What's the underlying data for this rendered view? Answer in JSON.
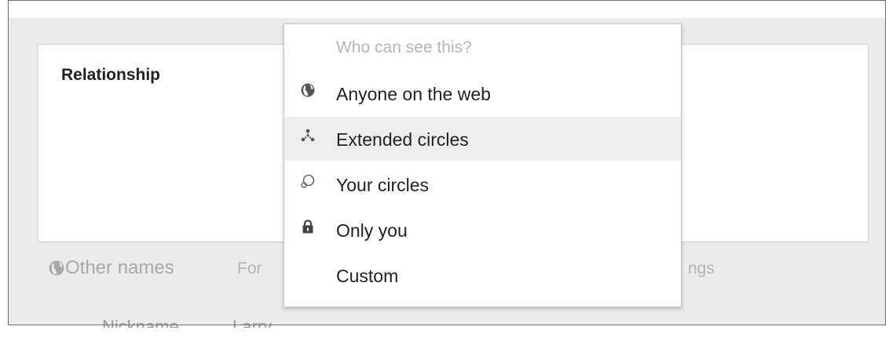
{
  "background": {
    "card_title": "Relationship",
    "other_names": {
      "label": "Other names",
      "value_left": "For",
      "value_right": "ngs"
    },
    "nickname": {
      "label": "Nickname",
      "value": "Larry"
    }
  },
  "dropdown": {
    "header": "Who can see this?",
    "items": [
      {
        "label": "Anyone on the web",
        "icon": "globe-icon"
      },
      {
        "label": "Extended circles",
        "icon": "extended-circles-icon",
        "highlighted": true
      },
      {
        "label": "Your circles",
        "icon": "circles-icon"
      },
      {
        "label": "Only you",
        "icon": "lock-icon"
      },
      {
        "label": "Custom",
        "icon": ""
      }
    ]
  },
  "colors": {
    "page_gray": "#ebebeb",
    "highlight": "#eeeeee",
    "muted_text": "#a8a8a8"
  }
}
